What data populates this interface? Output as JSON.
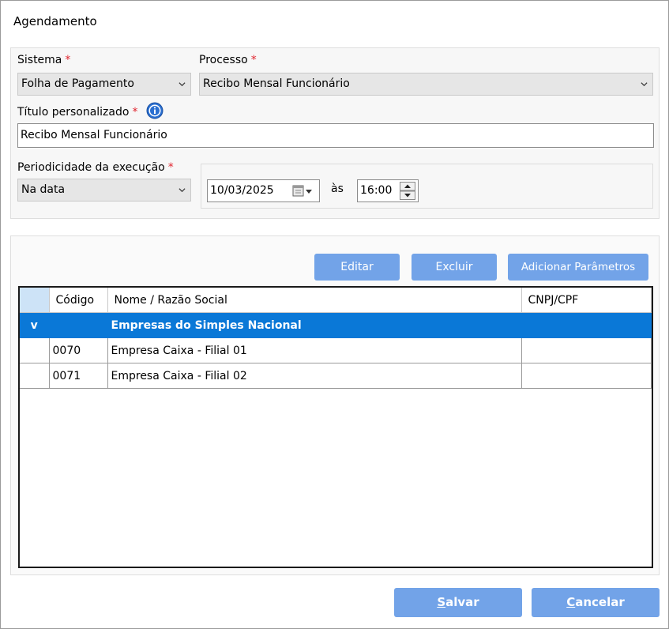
{
  "window": {
    "title": "Agendamento"
  },
  "form": {
    "sistema": {
      "label": "Sistema",
      "required": "*",
      "value": "Folha de Pagamento"
    },
    "processo": {
      "label": "Processo",
      "required": "*",
      "value": "Recibo Mensal Funcionário"
    },
    "titulo": {
      "label": "Título personalizado",
      "required": "*",
      "value": "Recibo Mensal Funcionário"
    },
    "periodicidade": {
      "label": "Periodicidade da execução",
      "required": "*",
      "value": "Na data"
    },
    "date": {
      "value": "10/03/2025"
    },
    "as_label": "às",
    "time": {
      "value": "16:00"
    }
  },
  "toolbar": {
    "editar": "Editar",
    "excluir": "Excluir",
    "adicionar": "Adicionar Parâmetros"
  },
  "grid": {
    "columns": [
      "Código",
      "Nome / Razão Social",
      "CNPJ/CPF"
    ],
    "group_row": {
      "marker": "v",
      "name": "Empresas do Simples Nacional"
    },
    "rows": [
      {
        "codigo": "0070",
        "nome": "Empresa Caixa - Filial 01",
        "cnpj": ""
      },
      {
        "codigo": "0071",
        "nome": "Empresa Caixa - Filial 02",
        "cnpj": ""
      }
    ]
  },
  "footer": {
    "salvar_first": "S",
    "salvar_rest": "alvar",
    "cancelar_first": "C",
    "cancelar_rest": "ancelar"
  },
  "colors": {
    "accent_button": "#72a3e8",
    "selected_row": "#0a78d7",
    "required": "#e0242e"
  }
}
